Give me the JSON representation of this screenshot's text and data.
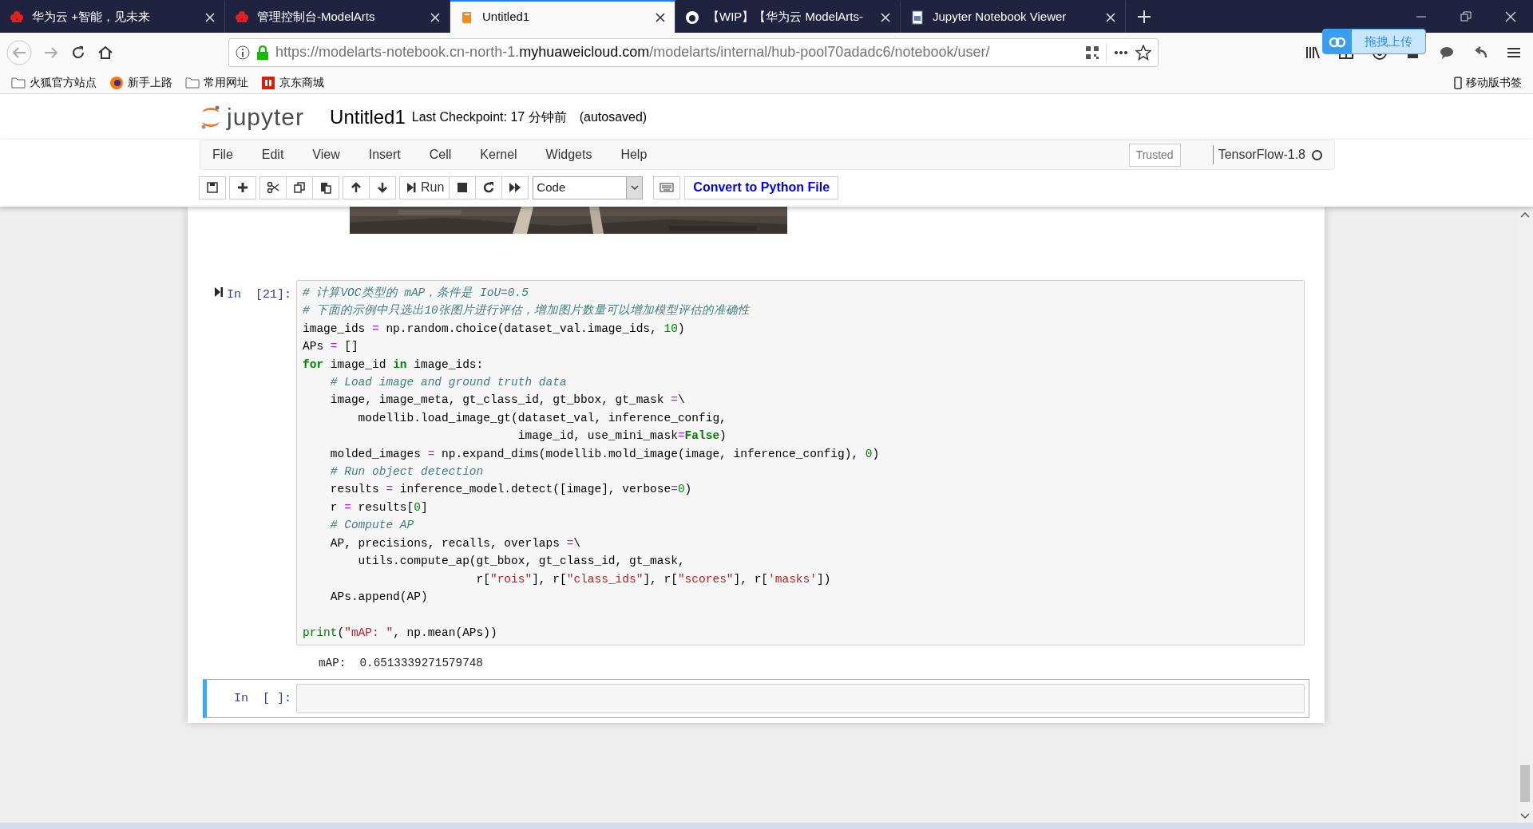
{
  "browser": {
    "tabs": [
      {
        "title": "华为云 +智能，见未来",
        "selected": false
      },
      {
        "title": "管理控制台-ModelArts",
        "selected": false
      },
      {
        "title": "Untitled1",
        "selected": true
      },
      {
        "title": "【WIP】【华为云 ModelArts-",
        "selected": false
      },
      {
        "title": "Jupyter Notebook Viewer",
        "selected": false
      }
    ],
    "address": {
      "prefix": "https://modelarts-notebook.cn-north-1.",
      "domain": "myhuaweicloud.com",
      "rest": "/modelarts/internal/hub-pool70adadc6/notebook/user/"
    },
    "upload_badge": "拖拽上传",
    "bookmarks": [
      {
        "label": "火狐官方站点"
      },
      {
        "label": "新手上路"
      },
      {
        "label": "常用网址"
      },
      {
        "label": "京东商城"
      }
    ],
    "mobile_bookmarks": "移动版书签"
  },
  "jupyter": {
    "logo_text": "jupyter",
    "notebook_name": "Untitled1",
    "checkpoint": "Last Checkpoint: 17 分钟前",
    "autosave": "(autosaved)",
    "menus": [
      "File",
      "Edit",
      "View",
      "Insert",
      "Cell",
      "Kernel",
      "Widgets",
      "Help"
    ],
    "trusted": "Trusted",
    "kernel": "TensorFlow-1.8",
    "kernel_busy": false,
    "toolbar": [
      {
        "kind": "save"
      },
      {
        "kind": "add"
      },
      {
        "kind": "cut"
      },
      {
        "kind": "copy"
      },
      {
        "kind": "paste"
      },
      {
        "kind": "up"
      },
      {
        "kind": "down"
      },
      {
        "kind": "run",
        "label": "Run"
      },
      {
        "kind": "stop"
      },
      {
        "kind": "restart"
      },
      {
        "kind": "fastforward"
      }
    ],
    "cell_type": "Code",
    "convert_button": "Convert to Python File"
  },
  "cells": [
    {
      "kind": "picture"
    },
    {
      "kind": "code",
      "prompt": "In  [21]:",
      "selected": false,
      "lines": [
        {
          "segments": [
            {
              "kind": "comment",
              "text": "# 计算VOC类型的 mAP，条件是 IoU=0.5"
            }
          ]
        },
        {
          "segments": [
            {
              "kind": "comment",
              "text": "# 下面的示例中只选出10张图片进行评估，增加图片数量可以增加模型评估的准确性"
            }
          ]
        },
        {
          "segments": [
            {
              "kind": "plain",
              "text": "image_ids "
            },
            {
              "kind": "operator",
              "text": "="
            },
            {
              "kind": "plain",
              "text": " np.random.choice(dataset_val.image_ids, "
            },
            {
              "kind": "number",
              "text": "10"
            },
            {
              "kind": "plain",
              "text": ")"
            }
          ]
        },
        {
          "segments": [
            {
              "kind": "plain",
              "text": "APs "
            },
            {
              "kind": "operator",
              "text": "="
            },
            {
              "kind": "plain",
              "text": " []"
            }
          ]
        },
        {
          "segments": [
            {
              "kind": "keyword",
              "text": "for"
            },
            {
              "kind": "plain",
              "text": " image_id "
            },
            {
              "kind": "keyword",
              "text": "in"
            },
            {
              "kind": "plain",
              "text": " image_ids:"
            }
          ]
        },
        {
          "segments": [
            {
              "kind": "comment",
              "text": "    # Load image and ground truth data"
            }
          ]
        },
        {
          "segments": [
            {
              "kind": "plain",
              "text": "    image, image_meta, gt_class_id, gt_bbox, gt_mask "
            },
            {
              "kind": "operator",
              "text": "="
            },
            {
              "kind": "plain",
              "text": "\\"
            }
          ]
        },
        {
          "segments": [
            {
              "kind": "plain",
              "text": "        modellib.load_image_gt(dataset_val, inference_config,"
            }
          ]
        },
        {
          "segments": [
            {
              "kind": "plain",
              "text": "                               image_id, use_mini_mask"
            },
            {
              "kind": "operator",
              "text": "="
            },
            {
              "kind": "keyword",
              "text": "False"
            },
            {
              "kind": "plain",
              "text": ")"
            }
          ]
        },
        {
          "segments": [
            {
              "kind": "plain",
              "text": "    molded_images "
            },
            {
              "kind": "operator",
              "text": "="
            },
            {
              "kind": "plain",
              "text": " np.expand_dims(modellib.mold_image(image, inference_config), "
            },
            {
              "kind": "number",
              "text": "0"
            },
            {
              "kind": "plain",
              "text": ")"
            }
          ]
        },
        {
          "segments": [
            {
              "kind": "comment",
              "text": "    # Run object detection"
            }
          ]
        },
        {
          "segments": [
            {
              "kind": "plain",
              "text": "    results "
            },
            {
              "kind": "operator",
              "text": "="
            },
            {
              "kind": "plain",
              "text": " inference_model.detect([image], verbose"
            },
            {
              "kind": "operator",
              "text": "="
            },
            {
              "kind": "number",
              "text": "0"
            },
            {
              "kind": "plain",
              "text": ")"
            }
          ]
        },
        {
          "segments": [
            {
              "kind": "plain",
              "text": "    r "
            },
            {
              "kind": "operator",
              "text": "="
            },
            {
              "kind": "plain",
              "text": " results["
            },
            {
              "kind": "number",
              "text": "0"
            },
            {
              "kind": "plain",
              "text": "]"
            }
          ]
        },
        {
          "segments": [
            {
              "kind": "comment",
              "text": "    # Compute AP"
            }
          ]
        },
        {
          "segments": [
            {
              "kind": "plain",
              "text": "    AP, precisions, recalls, overlaps "
            },
            {
              "kind": "operator",
              "text": "="
            },
            {
              "kind": "plain",
              "text": "\\"
            }
          ]
        },
        {
          "segments": [
            {
              "kind": "plain",
              "text": "        utils.compute_ap(gt_bbox, gt_class_id, gt_mask,"
            }
          ]
        },
        {
          "segments": [
            {
              "kind": "plain",
              "text": "                         r["
            },
            {
              "kind": "string",
              "text": "\"rois\""
            },
            {
              "kind": "plain",
              "text": "], r["
            },
            {
              "kind": "string",
              "text": "\"class_ids\""
            },
            {
              "kind": "plain",
              "text": "], r["
            },
            {
              "kind": "string",
              "text": "\"scores\""
            },
            {
              "kind": "plain",
              "text": "], r["
            },
            {
              "kind": "string",
              "text": "'masks'"
            },
            {
              "kind": "plain",
              "text": "])"
            }
          ]
        },
        {
          "segments": [
            {
              "kind": "plain",
              "text": "    APs.append(AP)"
            }
          ]
        },
        {
          "space_before": true,
          "segments": [
            {
              "kind": "builtin",
              "text": "print"
            },
            {
              "kind": "plain",
              "text": "("
            },
            {
              "kind": "string",
              "text": "\"mAP: \""
            },
            {
              "kind": "plain",
              "text": ", np.mean(APs))"
            }
          ]
        }
      ],
      "output": "mAP:  0.6513339271579748"
    },
    {
      "kind": "code",
      "prompt": "In  [ ]:",
      "selected": true
    }
  ]
}
